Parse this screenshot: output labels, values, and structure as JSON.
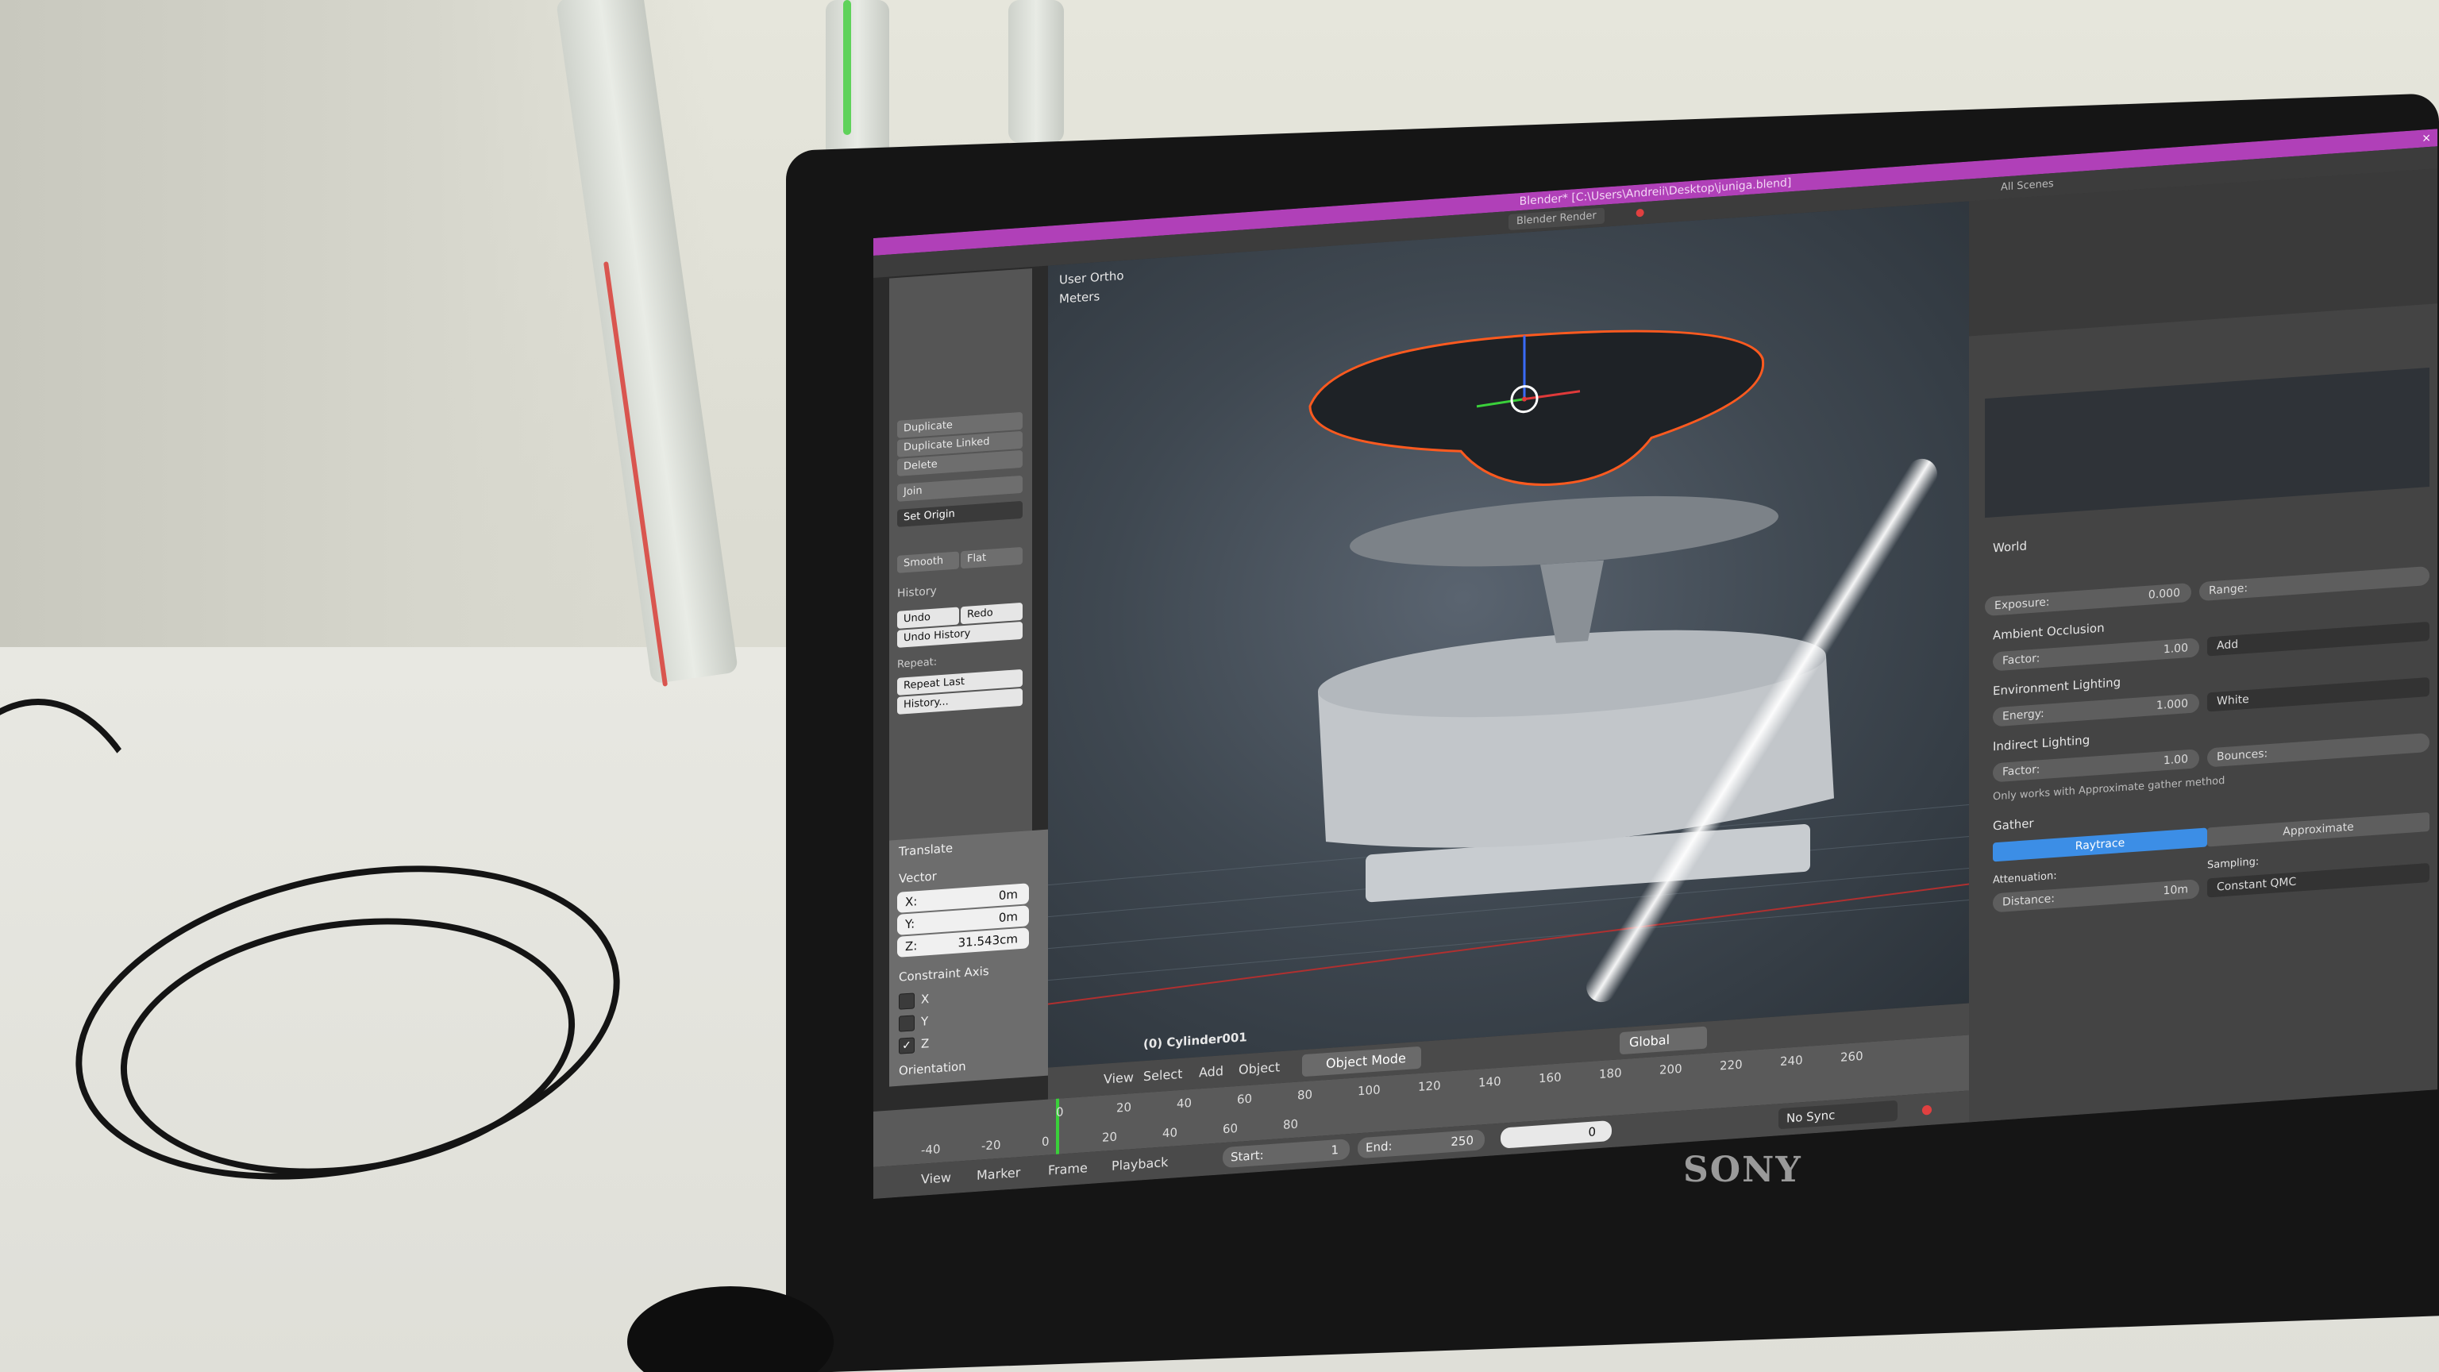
{
  "window_title": "Blender* [C:\\Users\\Andreii\\Desktop\\juniga.blend]",
  "render_engine": "Blender Render",
  "outliner_filter": "All Scenes",
  "tool_shelf": {
    "edit_buttons": [
      "Duplicate",
      "Duplicate Linked",
      "Delete",
      "Join"
    ],
    "set_origin": "Set Origin",
    "shading": [
      "Smooth",
      "Flat"
    ],
    "history_header": "History",
    "history_buttons": [
      "Undo",
      "Redo",
      "Undo History"
    ],
    "repeat_label": "Repeat:",
    "repeat_buttons": [
      "Repeat Last",
      "History..."
    ]
  },
  "operator_panel": {
    "title": "Translate",
    "vector_label": "Vector",
    "fields": [
      {
        "label": "X:",
        "value": "0m"
      },
      {
        "label": "Y:",
        "value": "0m"
      },
      {
        "label": "Z:",
        "value": "31.543cm"
      }
    ],
    "constraint_label": "Constraint Axis",
    "axes": [
      {
        "label": "X",
        "checked": false
      },
      {
        "label": "Y",
        "checked": false
      },
      {
        "label": "Z",
        "checked": true
      }
    ],
    "orientation_label": "Orientation"
  },
  "viewport": {
    "view_name": "User Ortho",
    "units": "Meters",
    "object_label": "(0) Cylinder001"
  },
  "view3d_header": {
    "menus": [
      "View",
      "Select",
      "Add",
      "Object"
    ],
    "mode": "Object Mode",
    "orientation": "Global"
  },
  "timeline": {
    "ticks_top": [
      "0",
      "20",
      "40",
      "60",
      "80",
      "100",
      "120",
      "140",
      "160",
      "180",
      "200",
      "220",
      "240",
      "260"
    ],
    "ticks_bottom": [
      "-40",
      "-20",
      "0",
      "20",
      "40",
      "60",
      "80"
    ],
    "menus": [
      "View",
      "Marker",
      "Frame",
      "Playback"
    ],
    "start": "Start:",
    "start_value": "1",
    "end": "End:",
    "end_value": "250",
    "current_frame": "0",
    "sync": "No Sync"
  },
  "properties": {
    "world_header": "World",
    "exposure_label": "Exposure:",
    "exposure_value": "0.000",
    "range_label": "Range:",
    "ambient_occlusion": "Ambient Occlusion",
    "ao_factor_label": "Factor:",
    "ao_factor_value": "1.00",
    "ao_blend": "Add",
    "environment_lighting": "Environment Lighting",
    "env_energy_label": "Energy:",
    "env_energy_value": "1.000",
    "env_color": "White",
    "indirect_lighting": "Indirect Lighting",
    "ind_factor_label": "Factor:",
    "ind_factor_value": "1.00",
    "bounces": "Bounces:",
    "indirect_note": "Only works with Approximate gather method",
    "gather_header": "Gather",
    "gather_tabs": [
      "Raytrace",
      "Approximate"
    ],
    "attenuation_label": "Attenuation:",
    "distance_label": "Distance:",
    "distance_value": "10m",
    "sampling_label": "Sampling:",
    "sampling_value": "Constant QMC"
  },
  "brand": "SONY",
  "colors": {
    "titlebar": "#b040b8",
    "selection_outline": "#ff5a1f",
    "accent_blue": "#3c8ee6"
  }
}
